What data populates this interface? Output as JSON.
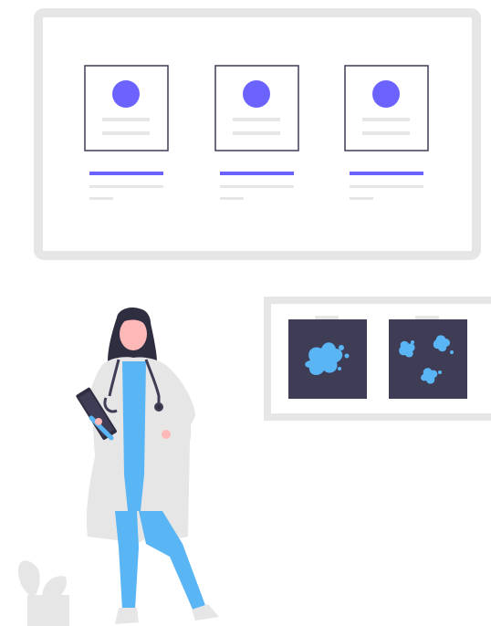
{
  "colors": {
    "frame": "#e6e6e6",
    "accent": "#6c63ff",
    "card_border": "#3f3d56",
    "line_light": "#e6e6e6",
    "xray_bg": "#3f3d56",
    "xray_spot": "#5ab5f5",
    "scrubs": "#5ab5f5",
    "coat": "#e6e6e6",
    "skin": "#ffb8b8",
    "hair": "#2f2e41",
    "plant": "#e6e6e6"
  },
  "profile_cards": [
    {
      "id": "doctor-1"
    },
    {
      "id": "doctor-2"
    },
    {
      "id": "doctor-3"
    }
  ],
  "xrays": [
    {
      "id": "xray-left"
    },
    {
      "id": "xray-right"
    }
  ]
}
